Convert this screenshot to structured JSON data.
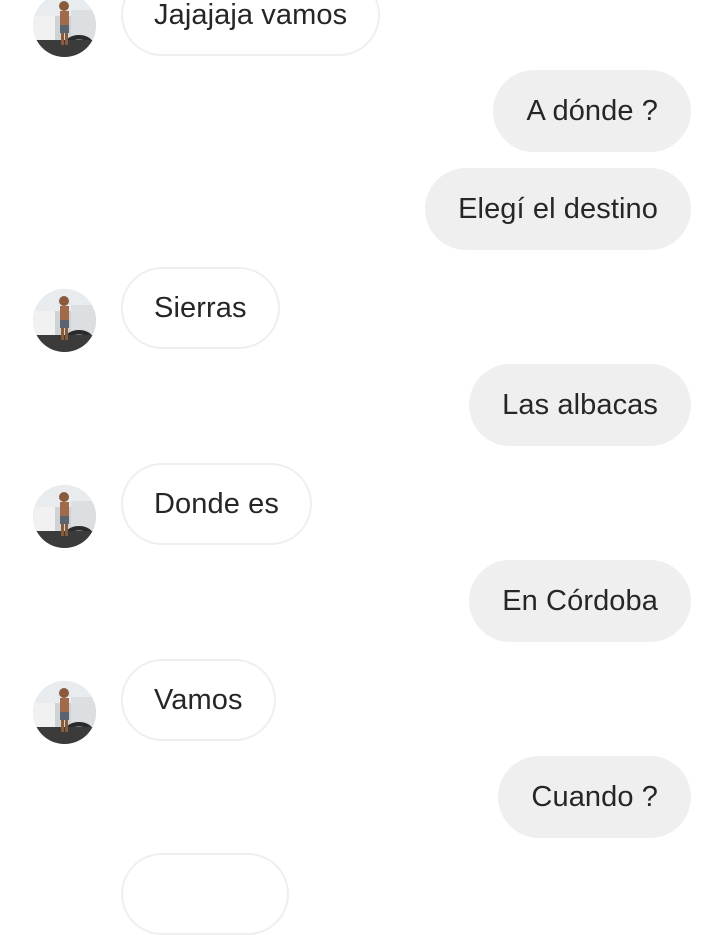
{
  "conversation": {
    "messages": [
      {
        "sender": "them",
        "text": "Jajajaja vamos",
        "avatar": "profile-photo"
      },
      {
        "sender": "me",
        "text": "A dónde ?"
      },
      {
        "sender": "me",
        "text": "Elegí el destino"
      },
      {
        "sender": "them",
        "text": "Sierras",
        "avatar": "profile-photo"
      },
      {
        "sender": "me",
        "text": "Las albacas"
      },
      {
        "sender": "them",
        "text": "Donde es",
        "avatar": "profile-photo"
      },
      {
        "sender": "me",
        "text": "En Córdoba"
      },
      {
        "sender": "them",
        "text": "Vamos",
        "avatar": "profile-photo"
      },
      {
        "sender": "me",
        "text": "Cuando ?"
      },
      {
        "sender": "them",
        "text": "",
        "avatar": null
      }
    ]
  },
  "colors": {
    "incoming_bubble_bg": "#ffffff",
    "incoming_bubble_border": "#efefef",
    "outgoing_bubble_bg": "#efefef",
    "text": "#262626",
    "background": "#ffffff"
  }
}
